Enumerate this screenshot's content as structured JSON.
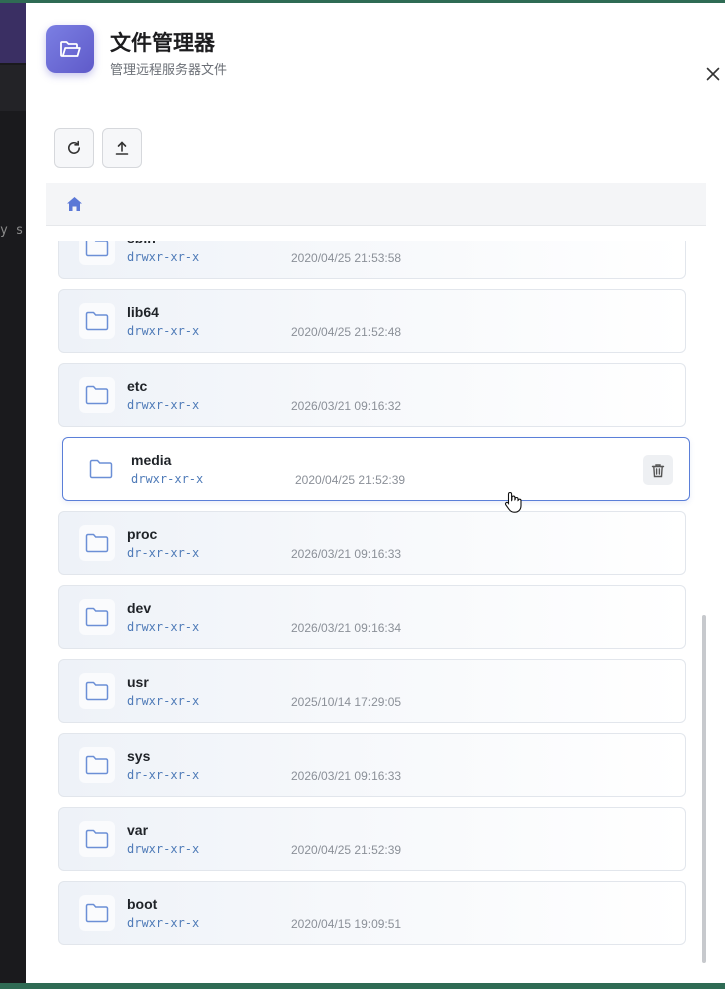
{
  "background": {
    "terminal_text": "y s"
  },
  "header": {
    "title": "文件管理器",
    "subtitle": "管理远程服务器文件",
    "icon": "folder-open-icon"
  },
  "toolbar": {
    "refresh_icon": "refresh-icon",
    "upload_icon": "upload-icon"
  },
  "breadcrumb": {
    "home_icon": "home-icon"
  },
  "files": [
    {
      "name": "sbin",
      "perm": "drwxr-xr-x",
      "date": "2020/04/25 21:53:58"
    },
    {
      "name": "lib64",
      "perm": "drwxr-xr-x",
      "date": "2020/04/25 21:52:48"
    },
    {
      "name": "etc",
      "perm": "drwxr-xr-x",
      "date": "2026/03/21 09:16:32"
    },
    {
      "name": "media",
      "perm": "drwxr-xr-x",
      "date": "2020/04/25 21:52:39",
      "hovered": true
    },
    {
      "name": "proc",
      "perm": "dr-xr-xr-x",
      "date": "2026/03/21 09:16:33"
    },
    {
      "name": "dev",
      "perm": "drwxr-xr-x",
      "date": "2026/03/21 09:16:34"
    },
    {
      "name": "usr",
      "perm": "drwxr-xr-x",
      "date": "2025/10/14 17:29:05"
    },
    {
      "name": "sys",
      "perm": "dr-xr-xr-x",
      "date": "2026/03/21 09:16:33"
    },
    {
      "name": "var",
      "perm": "drwxr-xr-x",
      "date": "2020/04/25 21:52:39"
    },
    {
      "name": "boot",
      "perm": "drwxr-xr-x",
      "date": "2020/04/15 19:09:51"
    }
  ],
  "colors": {
    "accent": "#6a67d6",
    "hover_border": "#5b7fd8",
    "perm_text": "#4f7bb8"
  }
}
